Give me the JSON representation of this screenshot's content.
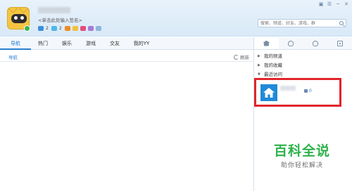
{
  "header": {
    "signature": "<单击此处输入签名>",
    "badge_numbers": [
      "2",
      "2"
    ],
    "search_placeholder": "搜索、频道、好友、游戏、群",
    "window_controls": [
      "▣",
      "☰",
      "─",
      "✕"
    ]
  },
  "tabs": [
    {
      "label": "导航",
      "active": true
    },
    {
      "label": "热门",
      "active": false
    },
    {
      "label": "娱乐",
      "active": false
    },
    {
      "label": "游戏",
      "active": false
    },
    {
      "label": "交友",
      "active": false
    },
    {
      "label": "我的YY",
      "active": false
    }
  ],
  "subbar": {
    "breadcrumb": "导航",
    "refresh_label": "刷新"
  },
  "right_panel": {
    "tree": [
      {
        "arrow": "▶",
        "label": "我的频道"
      },
      {
        "arrow": "▶",
        "label": "我的收藏"
      },
      {
        "arrow": "▼",
        "label": "最近访问"
      }
    ],
    "recent_item": {
      "count": "0"
    }
  },
  "watermark": {
    "title": "百科全说",
    "subtitle": "助你轻松解决"
  },
  "colors": {
    "accent": "#2a7fd4",
    "highlight_border": "#e2252b",
    "watermark_green": "#2eb24b"
  }
}
